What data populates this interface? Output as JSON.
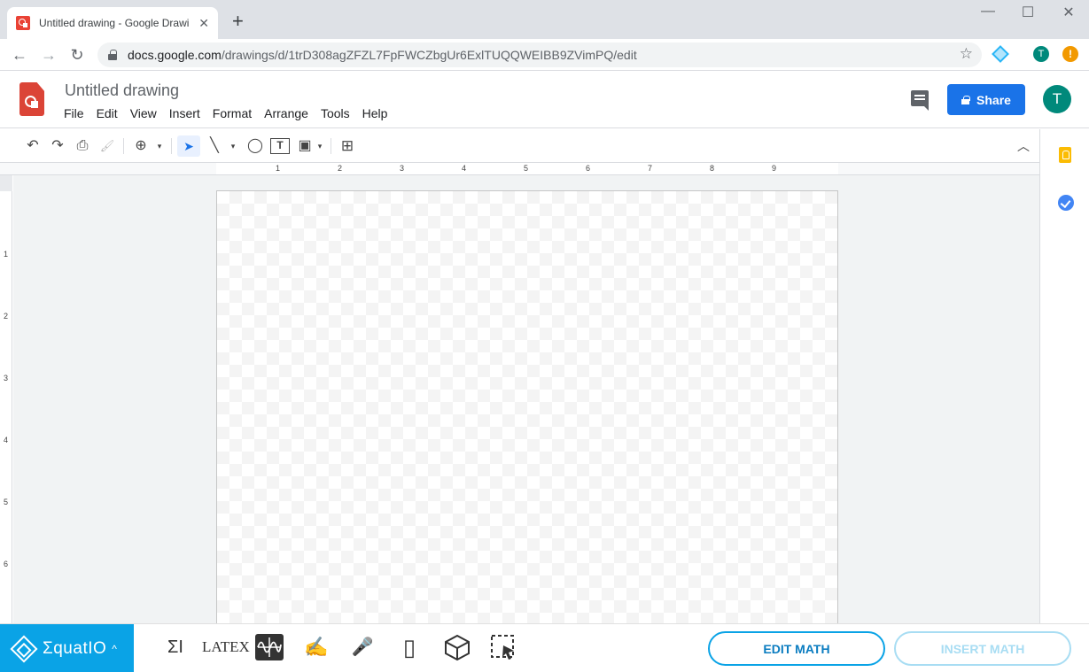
{
  "browser": {
    "tab_title": "Untitled drawing - Google Drawi",
    "tab_close": "✕",
    "new_tab": "+",
    "controls": {
      "minimize": "—",
      "maximize": "☐",
      "close": "✕"
    },
    "nav": {
      "back": "←",
      "forward": "→",
      "reload": "↻"
    },
    "url_host": "docs.google.com",
    "url_path": "/drawings/d/1trD308agZFZL7FpFWCZbgUr6ExlTUQQWEIBB9ZVimPQ/edit",
    "star": "☆",
    "ext_avatar": "T",
    "ext_alert": "!"
  },
  "app": {
    "title": "Untitled drawing",
    "menu": [
      "File",
      "Edit",
      "View",
      "Insert",
      "Format",
      "Arrange",
      "Tools",
      "Help"
    ],
    "share_label": "Share",
    "avatar_letter": "T"
  },
  "toolbar": {
    "undo": "↶",
    "redo": "↷",
    "print": "⎙",
    "paint_format": "🖌",
    "zoom": "⊕",
    "caret": "▾",
    "select": "➤",
    "line": "╲",
    "shape": "◯",
    "textbox": "T",
    "image": "▣",
    "comment": "⊞",
    "collapse": "︿"
  },
  "ruler": {
    "h_numbers": [
      "1",
      "2",
      "3",
      "4",
      "5",
      "6",
      "7",
      "8",
      "9"
    ],
    "v_numbers": [
      "1",
      "2",
      "3",
      "4",
      "5",
      "6"
    ]
  },
  "equatio": {
    "brand": "ΣquatIO",
    "caret": "^",
    "tools": {
      "math_input": "ΣI",
      "latex": "LATEX",
      "handwriting": "✍",
      "speech": "🎤",
      "mobile": "▯",
      "screenshot": "⬚"
    },
    "edit_math": "EDIT MATH",
    "insert_math": "INSERT MATH"
  }
}
